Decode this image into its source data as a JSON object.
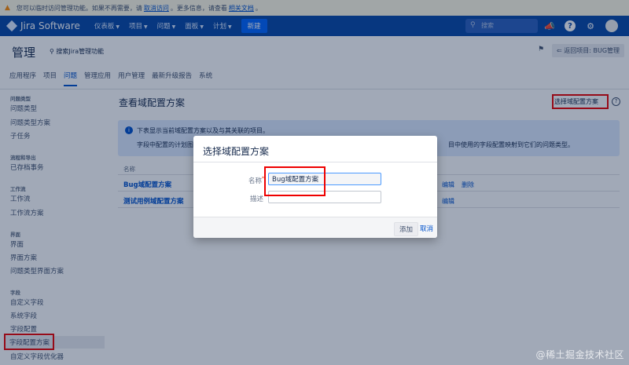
{
  "warning": {
    "text_before": "您可以临时访问管理功能。如果不再需要，请",
    "link1": "取消访问",
    "text_mid": "。更多信息，请查看",
    "link2": "相关文档",
    "text_end": "。"
  },
  "nav": {
    "logo": "Jira Software",
    "items": [
      "仪表板",
      "项目",
      "问题",
      "面板",
      "计划"
    ],
    "create": "新建",
    "search_placeholder": "搜索"
  },
  "admin": {
    "title": "管理",
    "search": "搜索Jira管理功能",
    "back": "返回项目: BUG管理",
    "tabs": [
      "应用程序",
      "项目",
      "问题",
      "管理应用",
      "用户管理",
      "最新升级报告",
      "系统"
    ],
    "active_tab": "问题"
  },
  "sidebar": {
    "sections": [
      {
        "title": "问题类型",
        "items": [
          "问题类型",
          "问题类型方案",
          "子任务"
        ]
      },
      {
        "title": "流程和导出",
        "items": [
          "已存档事务"
        ]
      },
      {
        "title": "工作流",
        "items": [
          "工作流",
          "工作流方案"
        ]
      },
      {
        "title": "界面",
        "items": [
          "界面",
          "界面方案",
          "问题类型界面方案"
        ]
      },
      {
        "title": "字段",
        "items": [
          "自定义字段",
          "系统字段",
          "字段配置",
          "字段配置方案",
          "自定义字段优化器"
        ]
      }
    ],
    "selected": "字段配置方案"
  },
  "main": {
    "title": "查看域配置方案",
    "choose_button": "选择域配置方案",
    "info_line1": "下表显示当前域配置方案以及与其关联的项目。",
    "info_line2_start": "字段中配置的计划图",
    "info_line2_end": "目中使用的字段配置映射到它们的问题类型。",
    "column_name": "名称",
    "rows": [
      {
        "name": "Bug域配置方案",
        "actions": [
          "编辑",
          "删除"
        ]
      },
      {
        "name": "测试用例域配置方案",
        "actions": [
          "编辑"
        ]
      }
    ]
  },
  "dialog": {
    "title": "选择域配置方案",
    "name_label": "名称",
    "name_value": "Bug域配置方案",
    "desc_label": "描述",
    "desc_value": "",
    "add": "添加",
    "cancel": "取消"
  },
  "watermark": "@稀土掘金技术社区",
  "colors": {
    "nav": "#0747a6",
    "link": "#0052cc",
    "highlight": "#e00000"
  }
}
